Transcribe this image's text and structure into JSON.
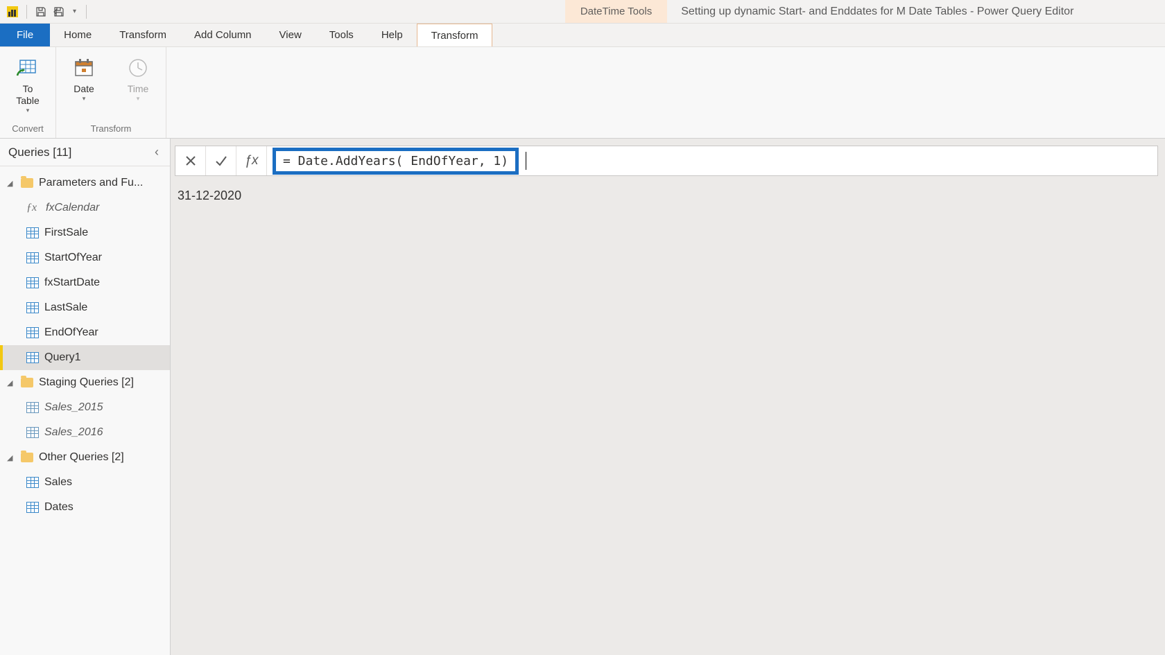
{
  "titlebar": {
    "context_label": "DateTime Tools",
    "document_title": "Setting up dynamic Start- and Enddates for M Date Tables - Power Query Editor"
  },
  "tabs": {
    "file": "File",
    "home": "Home",
    "transform": "Transform",
    "add_column": "Add Column",
    "view": "View",
    "tools": "Tools",
    "help": "Help",
    "context_transform": "Transform"
  },
  "ribbon": {
    "convert": {
      "to_table": "To\nTable",
      "group_label": "Convert"
    },
    "transform": {
      "date": "Date",
      "time": "Time",
      "group_label": "Transform"
    }
  },
  "queries": {
    "title": "Queries [11]",
    "groups": [
      {
        "label": "Parameters and Fu...",
        "items": [
          {
            "label": "fxCalendar",
            "icon": "fx",
            "italic": true
          },
          {
            "label": "FirstSale",
            "icon": "table"
          },
          {
            "label": "StartOfYear",
            "icon": "table"
          },
          {
            "label": "fxStartDate",
            "icon": "table"
          },
          {
            "label": "LastSale",
            "icon": "table"
          },
          {
            "label": "EndOfYear",
            "icon": "table"
          },
          {
            "label": "Query1",
            "icon": "table",
            "selected": true
          }
        ]
      },
      {
        "label": "Staging Queries [2]",
        "items": [
          {
            "label": "Sales_2015",
            "icon": "table",
            "italic": true,
            "dim": true
          },
          {
            "label": "Sales_2016",
            "icon": "table",
            "italic": true,
            "dim": true
          }
        ]
      },
      {
        "label": "Other Queries [2]",
        "items": [
          {
            "label": "Sales",
            "icon": "table"
          },
          {
            "label": "Dates",
            "icon": "table"
          }
        ]
      }
    ]
  },
  "formula_bar": {
    "formula": "= Date.AddYears( EndOfYear, 1)"
  },
  "result": {
    "value": "31-12-2020"
  }
}
